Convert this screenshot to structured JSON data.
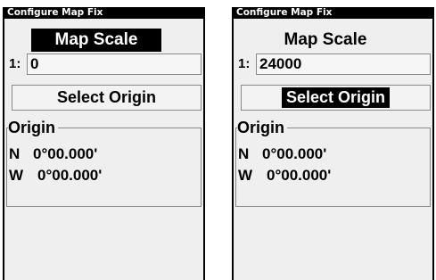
{
  "screens": [
    {
      "title": "Configure Map Fix",
      "map_scale_label": "Map Scale",
      "scale_prefix": "1:",
      "scale_value": "0",
      "select_origin_label": "Select Origin",
      "origin_group_label": "Origin",
      "origin": {
        "lat_dir": "N",
        "lat_value": "0°00.000'",
        "lon_dir": "W",
        "lon_value": "0°00.000'"
      },
      "focused_control": "Map Scale"
    },
    {
      "title": "Configure Map Fix",
      "map_scale_label": "Map Scale",
      "scale_prefix": "1:",
      "scale_value": "24000",
      "select_origin_label": "Select Origin",
      "origin_group_label": "Origin",
      "origin": {
        "lat_dir": "N",
        "lat_value": "0°00.000'",
        "lon_dir": "W",
        "lon_value": "0°00.000'"
      },
      "focused_control": "Select Origin"
    }
  ],
  "colors": {
    "panel_background": "#efefef",
    "highlight": "#000000",
    "highlight_text": "#ffffff",
    "border": "#888888"
  }
}
